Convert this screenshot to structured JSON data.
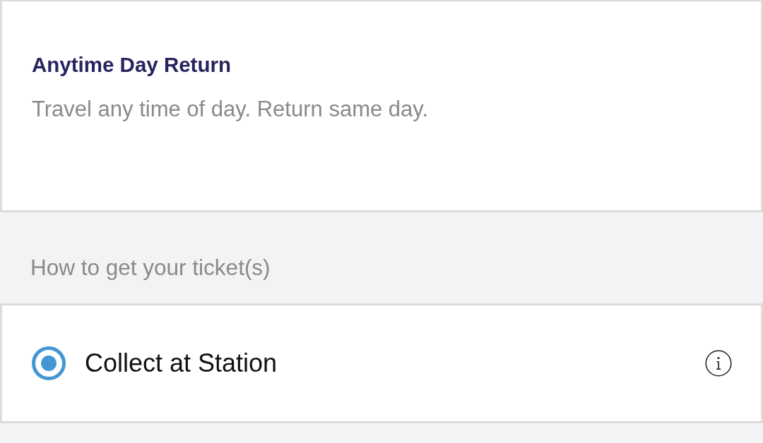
{
  "fare": {
    "title": "Anytime Day Return",
    "description": "Travel any time of day. Return same day."
  },
  "delivery": {
    "heading": "How to get your ticket(s)",
    "options": [
      {
        "label": "Collect at Station",
        "selected": true,
        "info": true
      }
    ]
  }
}
